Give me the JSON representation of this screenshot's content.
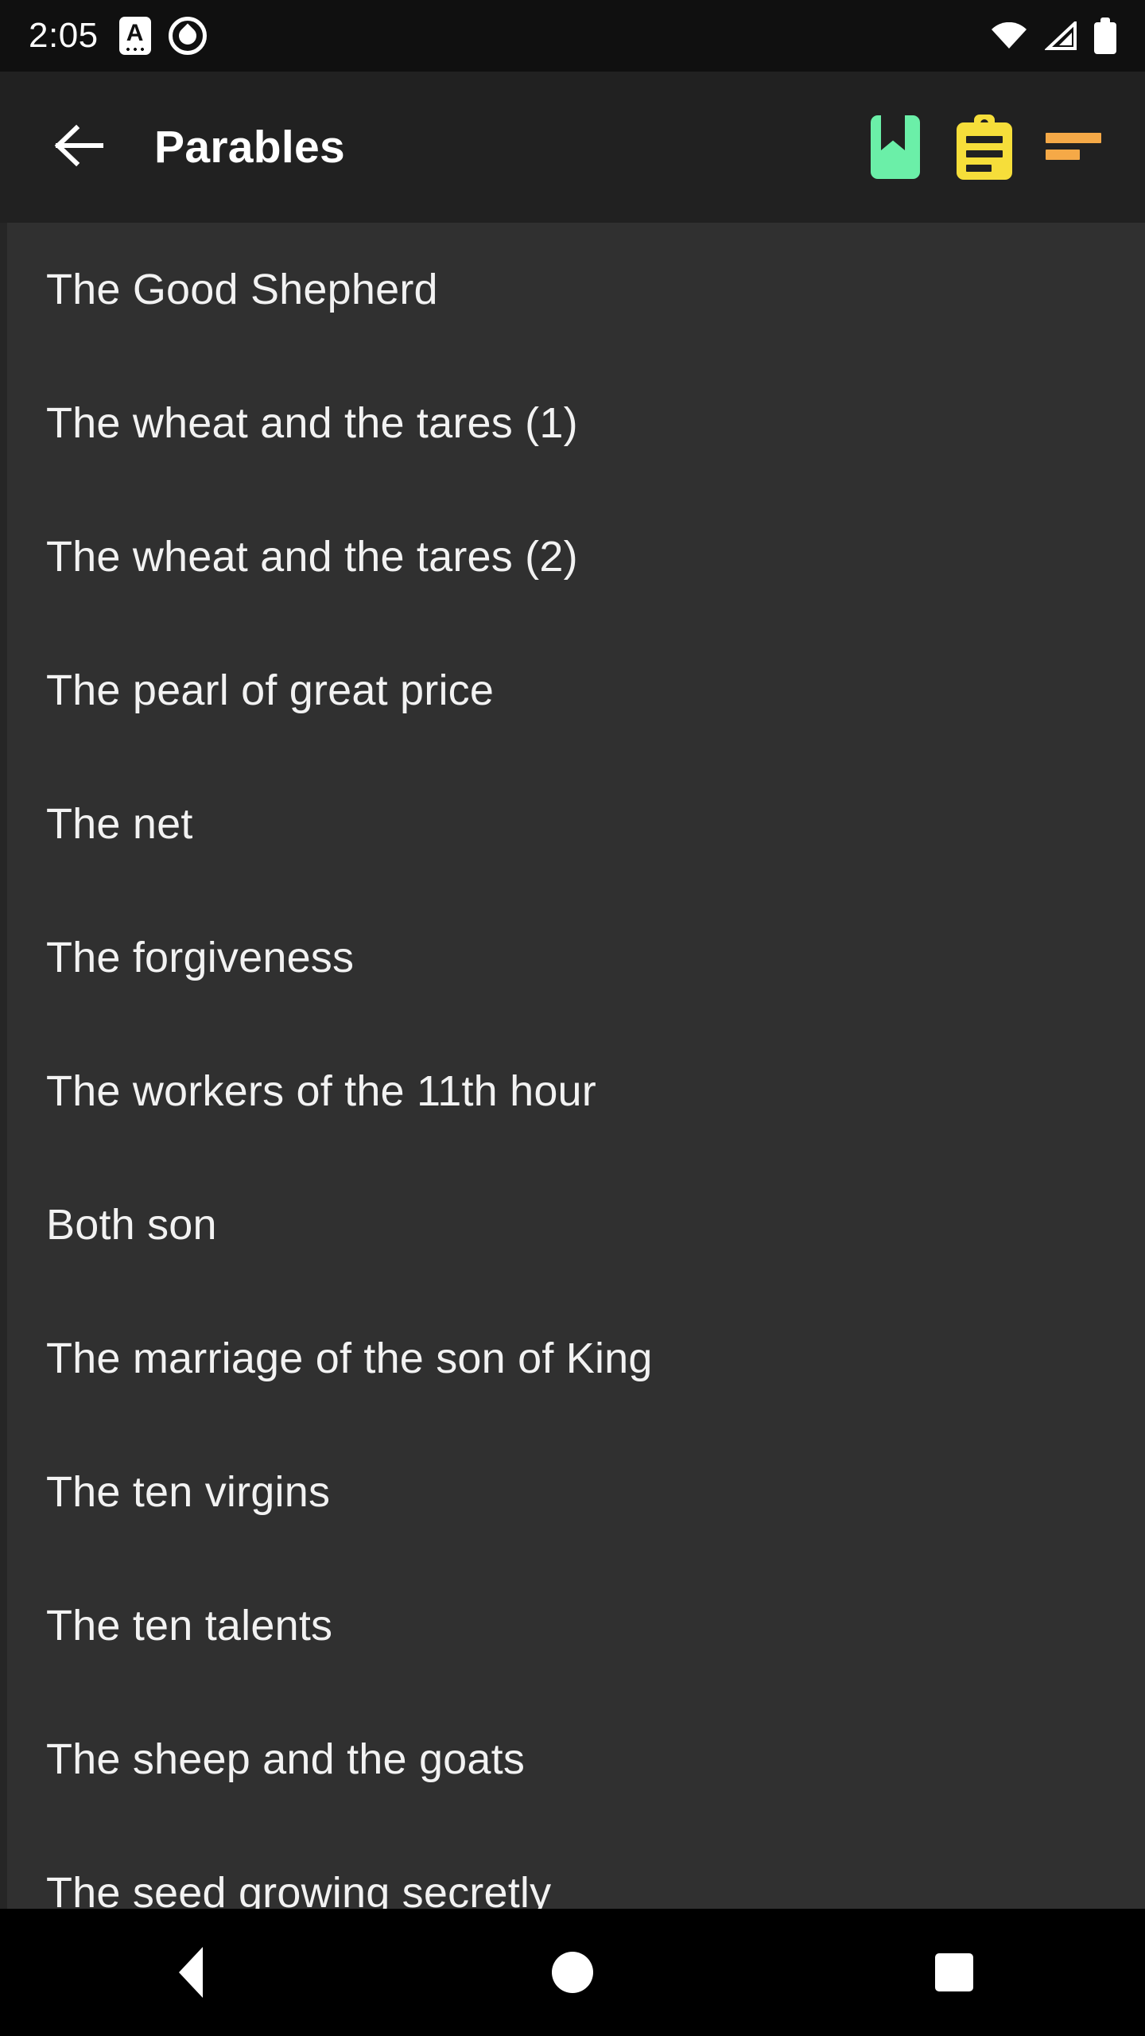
{
  "status_bar": {
    "clock": "2:05",
    "left_icons": [
      {
        "name": "notification-a-icon",
        "glyph": "A"
      },
      {
        "name": "do-not-disturb-icon",
        "glyph": "◎"
      }
    ],
    "right_icons": [
      {
        "name": "wifi-icon",
        "label": "Wi-Fi"
      },
      {
        "name": "cellular-signal-icon",
        "label": "Cellular signal"
      },
      {
        "name": "battery-icon",
        "label": "Battery full"
      }
    ],
    "background_color": "#101010"
  },
  "app_bar": {
    "back_label": "Back",
    "title": "Parables",
    "background_color": "#212121",
    "actions": [
      {
        "name": "bookmark-button",
        "label": "Bookmarks",
        "color": "#6BEFA8"
      },
      {
        "name": "notes-button",
        "label": "Notes",
        "color": "#F6DE3A"
      },
      {
        "name": "sort-button",
        "label": "Sort",
        "color": "#F5A947"
      }
    ]
  },
  "list": {
    "background_color": "#303030",
    "text_color": "#F2F2F2",
    "items": [
      {
        "label": "The Good Shepherd"
      },
      {
        "label": "The wheat and the tares (1)"
      },
      {
        "label": "The wheat and the tares (2)"
      },
      {
        "label": "The pearl of great price"
      },
      {
        "label": "The net"
      },
      {
        "label": "The forgiveness"
      },
      {
        "label": "The workers of the 11th hour"
      },
      {
        "label": "Both son"
      },
      {
        "label": "The marriage of the son of King"
      },
      {
        "label": "The ten virgins"
      },
      {
        "label": "The ten talents"
      },
      {
        "label": "The sheep and the goats"
      },
      {
        "label": "The seed growing secretly"
      }
    ]
  },
  "nav_bar": {
    "background_color": "#000000",
    "buttons": [
      {
        "name": "nav-back-button",
        "label": "Back"
      },
      {
        "name": "nav-home-button",
        "label": "Home"
      },
      {
        "name": "nav-recents-button",
        "label": "Recents"
      }
    ]
  }
}
